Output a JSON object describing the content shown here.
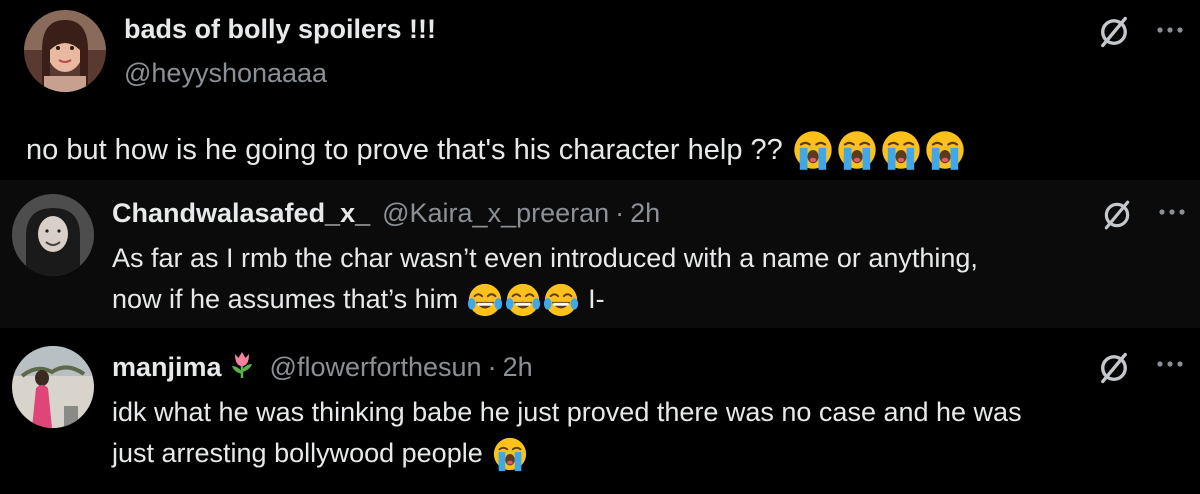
{
  "main_tweet": {
    "display_name": "bads of bolly spoilers !!!",
    "handle": "@heyyshonaaaa",
    "text": "no but how is he going to prove that's his character help ??",
    "emojis": [
      "loudly-crying-face",
      "loudly-crying-face",
      "loudly-crying-face",
      "loudly-crying-face"
    ]
  },
  "replies": [
    {
      "display_name": "Chandwalasafed_x_",
      "handle": "@Kaira_x_preeran",
      "separator": "·",
      "time": "2h",
      "text_line1": "As far as I rmb the char wasn’t even introduced with a name or anything,",
      "text_line2": "now if he assumes that’s him",
      "text_line2_suffix": "I-",
      "emojis": [
        "face-with-tears-of-joy",
        "face-with-tears-of-joy",
        "face-with-tears-of-joy"
      ]
    },
    {
      "display_name": "manjima",
      "name_emoji": "tulip",
      "handle": "@flowerforthesun",
      "separator": "·",
      "time": "2h",
      "text_line1": "idk what he was thinking babe he just proved there was no case and he was",
      "text_line2": "just arresting bollywood people",
      "emojis": [
        "loudly-crying-face"
      ]
    }
  ],
  "icons": {
    "grok": "grok-slash-circle-icon",
    "more": "more-dots-icon"
  },
  "colors": {
    "background": "#000000",
    "reply_background": "#0b0b0b",
    "primary_text": "#e7e9ea",
    "secondary_text": "#8b9096",
    "emoji_yellow": "#fcc21b"
  }
}
